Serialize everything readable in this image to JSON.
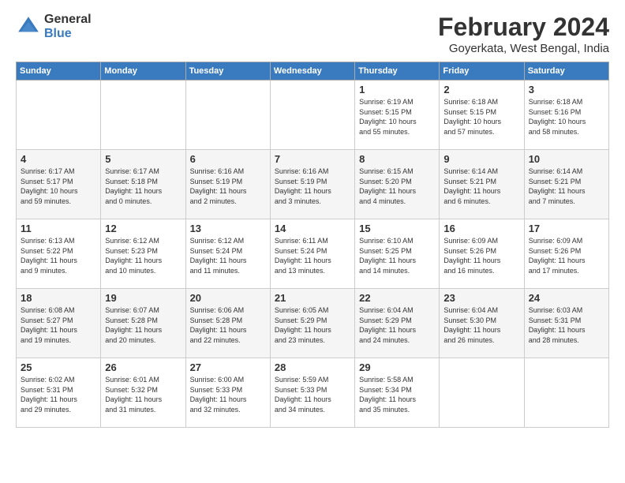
{
  "header": {
    "logo_general": "General",
    "logo_blue": "Blue",
    "month_title": "February 2024",
    "location": "Goyerkata, West Bengal, India"
  },
  "weekdays": [
    "Sunday",
    "Monday",
    "Tuesday",
    "Wednesday",
    "Thursday",
    "Friday",
    "Saturday"
  ],
  "weeks": [
    [
      {
        "day": "",
        "content": ""
      },
      {
        "day": "",
        "content": ""
      },
      {
        "day": "",
        "content": ""
      },
      {
        "day": "",
        "content": ""
      },
      {
        "day": "1",
        "content": "Sunrise: 6:19 AM\nSunset: 5:15 PM\nDaylight: 10 hours\nand 55 minutes."
      },
      {
        "day": "2",
        "content": "Sunrise: 6:18 AM\nSunset: 5:15 PM\nDaylight: 10 hours\nand 57 minutes."
      },
      {
        "day": "3",
        "content": "Sunrise: 6:18 AM\nSunset: 5:16 PM\nDaylight: 10 hours\nand 58 minutes."
      }
    ],
    [
      {
        "day": "4",
        "content": "Sunrise: 6:17 AM\nSunset: 5:17 PM\nDaylight: 10 hours\nand 59 minutes."
      },
      {
        "day": "5",
        "content": "Sunrise: 6:17 AM\nSunset: 5:18 PM\nDaylight: 11 hours\nand 0 minutes."
      },
      {
        "day": "6",
        "content": "Sunrise: 6:16 AM\nSunset: 5:19 PM\nDaylight: 11 hours\nand 2 minutes."
      },
      {
        "day": "7",
        "content": "Sunrise: 6:16 AM\nSunset: 5:19 PM\nDaylight: 11 hours\nand 3 minutes."
      },
      {
        "day": "8",
        "content": "Sunrise: 6:15 AM\nSunset: 5:20 PM\nDaylight: 11 hours\nand 4 minutes."
      },
      {
        "day": "9",
        "content": "Sunrise: 6:14 AM\nSunset: 5:21 PM\nDaylight: 11 hours\nand 6 minutes."
      },
      {
        "day": "10",
        "content": "Sunrise: 6:14 AM\nSunset: 5:21 PM\nDaylight: 11 hours\nand 7 minutes."
      }
    ],
    [
      {
        "day": "11",
        "content": "Sunrise: 6:13 AM\nSunset: 5:22 PM\nDaylight: 11 hours\nand 9 minutes."
      },
      {
        "day": "12",
        "content": "Sunrise: 6:12 AM\nSunset: 5:23 PM\nDaylight: 11 hours\nand 10 minutes."
      },
      {
        "day": "13",
        "content": "Sunrise: 6:12 AM\nSunset: 5:24 PM\nDaylight: 11 hours\nand 11 minutes."
      },
      {
        "day": "14",
        "content": "Sunrise: 6:11 AM\nSunset: 5:24 PM\nDaylight: 11 hours\nand 13 minutes."
      },
      {
        "day": "15",
        "content": "Sunrise: 6:10 AM\nSunset: 5:25 PM\nDaylight: 11 hours\nand 14 minutes."
      },
      {
        "day": "16",
        "content": "Sunrise: 6:09 AM\nSunset: 5:26 PM\nDaylight: 11 hours\nand 16 minutes."
      },
      {
        "day": "17",
        "content": "Sunrise: 6:09 AM\nSunset: 5:26 PM\nDaylight: 11 hours\nand 17 minutes."
      }
    ],
    [
      {
        "day": "18",
        "content": "Sunrise: 6:08 AM\nSunset: 5:27 PM\nDaylight: 11 hours\nand 19 minutes."
      },
      {
        "day": "19",
        "content": "Sunrise: 6:07 AM\nSunset: 5:28 PM\nDaylight: 11 hours\nand 20 minutes."
      },
      {
        "day": "20",
        "content": "Sunrise: 6:06 AM\nSunset: 5:28 PM\nDaylight: 11 hours\nand 22 minutes."
      },
      {
        "day": "21",
        "content": "Sunrise: 6:05 AM\nSunset: 5:29 PM\nDaylight: 11 hours\nand 23 minutes."
      },
      {
        "day": "22",
        "content": "Sunrise: 6:04 AM\nSunset: 5:29 PM\nDaylight: 11 hours\nand 24 minutes."
      },
      {
        "day": "23",
        "content": "Sunrise: 6:04 AM\nSunset: 5:30 PM\nDaylight: 11 hours\nand 26 minutes."
      },
      {
        "day": "24",
        "content": "Sunrise: 6:03 AM\nSunset: 5:31 PM\nDaylight: 11 hours\nand 28 minutes."
      }
    ],
    [
      {
        "day": "25",
        "content": "Sunrise: 6:02 AM\nSunset: 5:31 PM\nDaylight: 11 hours\nand 29 minutes."
      },
      {
        "day": "26",
        "content": "Sunrise: 6:01 AM\nSunset: 5:32 PM\nDaylight: 11 hours\nand 31 minutes."
      },
      {
        "day": "27",
        "content": "Sunrise: 6:00 AM\nSunset: 5:33 PM\nDaylight: 11 hours\nand 32 minutes."
      },
      {
        "day": "28",
        "content": "Sunrise: 5:59 AM\nSunset: 5:33 PM\nDaylight: 11 hours\nand 34 minutes."
      },
      {
        "day": "29",
        "content": "Sunrise: 5:58 AM\nSunset: 5:34 PM\nDaylight: 11 hours\nand 35 minutes."
      },
      {
        "day": "",
        "content": ""
      },
      {
        "day": "",
        "content": ""
      }
    ]
  ]
}
